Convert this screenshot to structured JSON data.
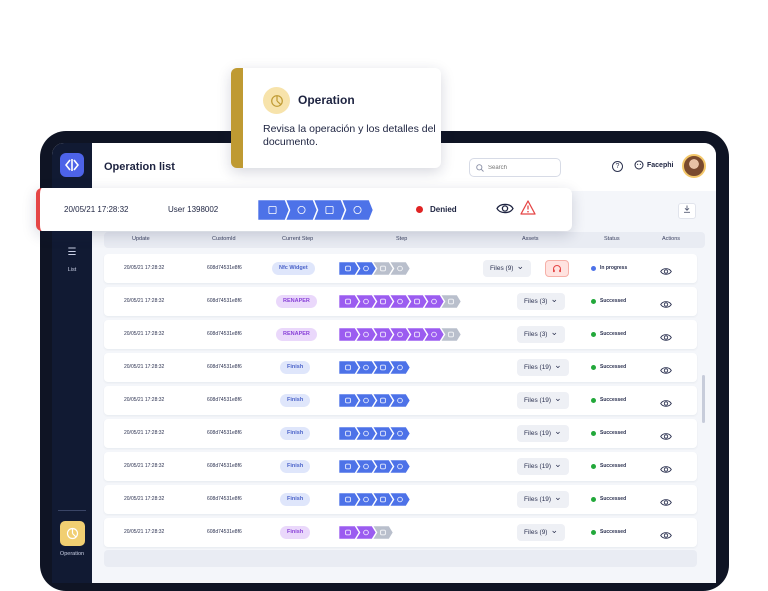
{
  "app": {
    "title": "Operation list",
    "company": "Facephi"
  },
  "search": {
    "placeholder": "Search"
  },
  "sidebar": {
    "list_label": "List",
    "operation_label": "Operation"
  },
  "operation_card": {
    "title": "Operation",
    "description": "Revisa la operación y los detalles del documento."
  },
  "highlighted_row": {
    "date": "20/05/21 17:28:32",
    "user": "User 1398002",
    "status": "Denied",
    "status_color": "#e02424"
  },
  "table": {
    "headers": [
      "Update",
      "CustomId",
      "Current Step",
      "Step",
      "Assets",
      "Status",
      "Actions"
    ],
    "rows": [
      {
        "update": "20/05/21 17:28:32",
        "custom_id": "608d74531e8f6",
        "current_step": "Nfc Widget",
        "step_style": "blue",
        "steps": "partial",
        "files": "Files (9)",
        "support": true,
        "status": "In progress",
        "status_color": "#4d72e8"
      },
      {
        "update": "20/05/21 17:28:32",
        "custom_id": "608d74531e8f6",
        "current_step": "RENAPER",
        "step_style": "purple",
        "steps": "long",
        "files": "Files (3)",
        "support": false,
        "status": "Successed",
        "status_color": "#22a83a"
      },
      {
        "update": "20/05/21 17:28:32",
        "custom_id": "608d74531e8f6",
        "current_step": "RENAPER",
        "step_style": "purple",
        "steps": "long",
        "files": "Files (3)",
        "support": false,
        "status": "Successed",
        "status_color": "#22a83a"
      },
      {
        "update": "20/05/21 17:28:32",
        "custom_id": "608d74531e8f6",
        "current_step": "Finish",
        "step_style": "blue",
        "steps": "full",
        "files": "Files (19)",
        "support": false,
        "status": "Successed",
        "status_color": "#22a83a"
      },
      {
        "update": "20/05/21 17:28:32",
        "custom_id": "608d74531e8f6",
        "current_step": "Finish",
        "step_style": "blue",
        "steps": "full",
        "files": "Files (19)",
        "support": false,
        "status": "Successed",
        "status_color": "#22a83a"
      },
      {
        "update": "20/05/21 17:28:32",
        "custom_id": "608d74531e8f6",
        "current_step": "Finish",
        "step_style": "blue",
        "steps": "full",
        "files": "Files (19)",
        "support": false,
        "status": "Successed",
        "status_color": "#22a83a"
      },
      {
        "update": "20/05/21 17:28:32",
        "custom_id": "608d74531e8f6",
        "current_step": "Finish",
        "step_style": "blue",
        "steps": "full",
        "files": "Files (19)",
        "support": false,
        "status": "Successed",
        "status_color": "#22a83a"
      },
      {
        "update": "20/05/21 17:28:32",
        "custom_id": "608d74531e8f6",
        "current_step": "Finish",
        "step_style": "blue",
        "steps": "full",
        "files": "Files (19)",
        "support": false,
        "status": "Successed",
        "status_color": "#22a83a"
      },
      {
        "update": "20/05/21 17:28:32",
        "custom_id": "608d74531e8f6",
        "current_step": "Finish",
        "step_style": "purple",
        "steps": "short",
        "files": "Files (9)",
        "support": false,
        "status": "Successed",
        "status_color": "#22a83a"
      }
    ]
  },
  "colors": {
    "accent": "#4d63e8",
    "sidebar": "#111a33",
    "step_blue": "#4d72e8",
    "step_purple": "#9b5cf0",
    "step_grey": "#b9bfcc",
    "card_accent": "#bf9a32"
  },
  "icons": {
    "logo": "code-brackets-icon",
    "list": "list-icon",
    "operation": "pie-chart-icon",
    "view": "eye-icon",
    "warning": "warning-triangle-icon",
    "support": "headset-icon",
    "download": "download-icon"
  }
}
